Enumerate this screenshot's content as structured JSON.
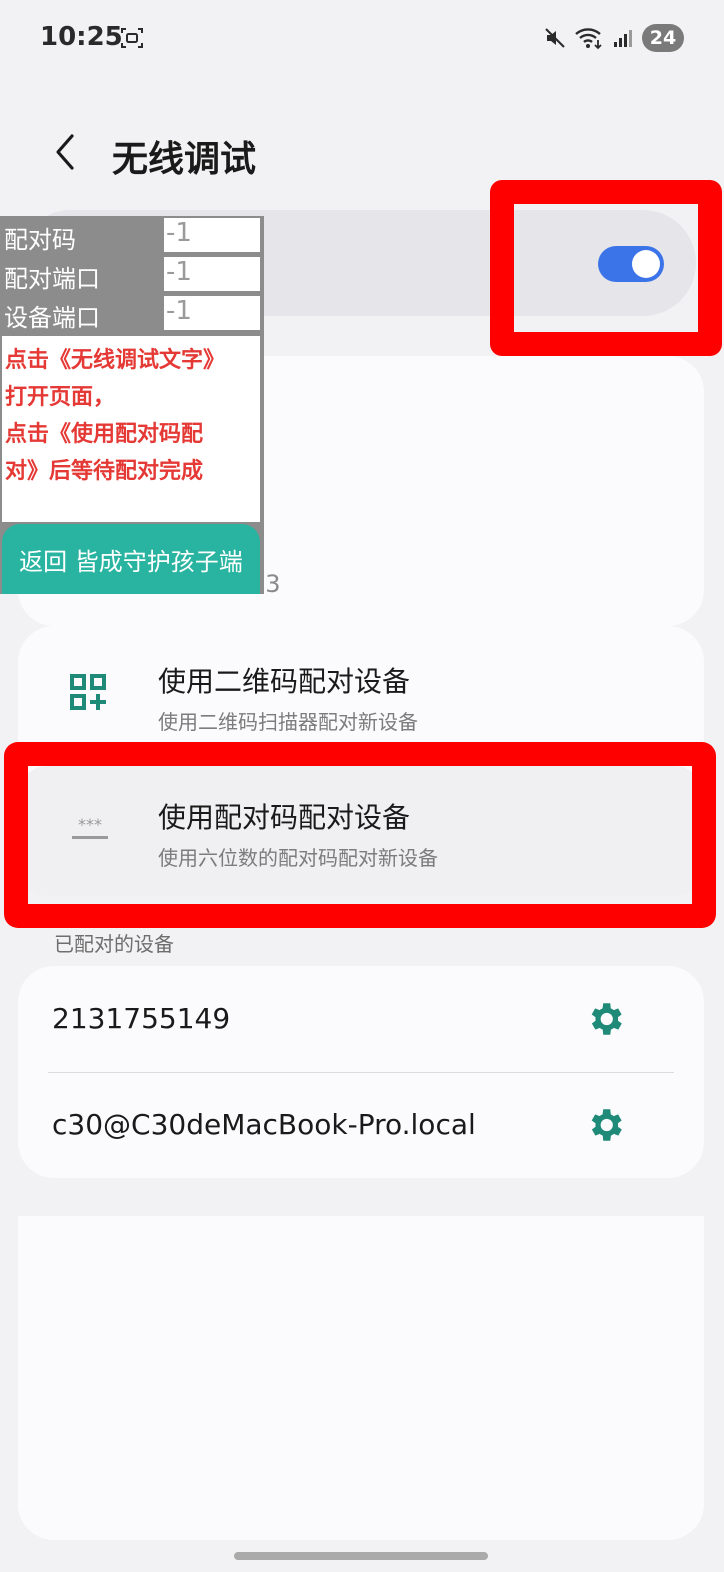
{
  "status_bar": {
    "time": "10:25",
    "battery": "24",
    "icons": [
      "screenshot-icon",
      "mute-icon",
      "wifi-icon",
      "signal-icon"
    ]
  },
  "header": {
    "title": "无线调试",
    "back_icon": "back-arrow-icon"
  },
  "toggle": {
    "state": "on",
    "color": "#3b74e8"
  },
  "info_card": {
    "partial_text": "33"
  },
  "overlay": {
    "rows": [
      {
        "label": "配对码",
        "value": "-1"
      },
      {
        "label": "配对端口",
        "value": "-1"
      },
      {
        "label": "设备端口",
        "value": "-1"
      }
    ],
    "instructions": [
      "点击《无线调试文字》",
      "打开页面，",
      "点击《使用配对码配",
      "对》后等待配对完成"
    ],
    "return_button": "返回 皆成守护孩子端",
    "instruction_color": "#e53935",
    "button_color": "#28b4a0"
  },
  "pairing": {
    "qr": {
      "title": "使用二维码配对设备",
      "subtitle": "使用二维码扫描器配对新设备",
      "icon": "qr-code-icon"
    },
    "code": {
      "title": "使用配对码配对设备",
      "subtitle": "使用六位数的配对码配对新设备",
      "icon": "asterisk-code-icon"
    }
  },
  "paired_devices": {
    "label": "已配对的设备",
    "items": [
      {
        "name": "2131755149",
        "icon": "gear-icon"
      },
      {
        "name": "c30@C30deMacBook-Pro.local",
        "icon": "gear-icon"
      }
    ],
    "accent": "#1f8a78"
  },
  "highlight_color": "#ff0000"
}
